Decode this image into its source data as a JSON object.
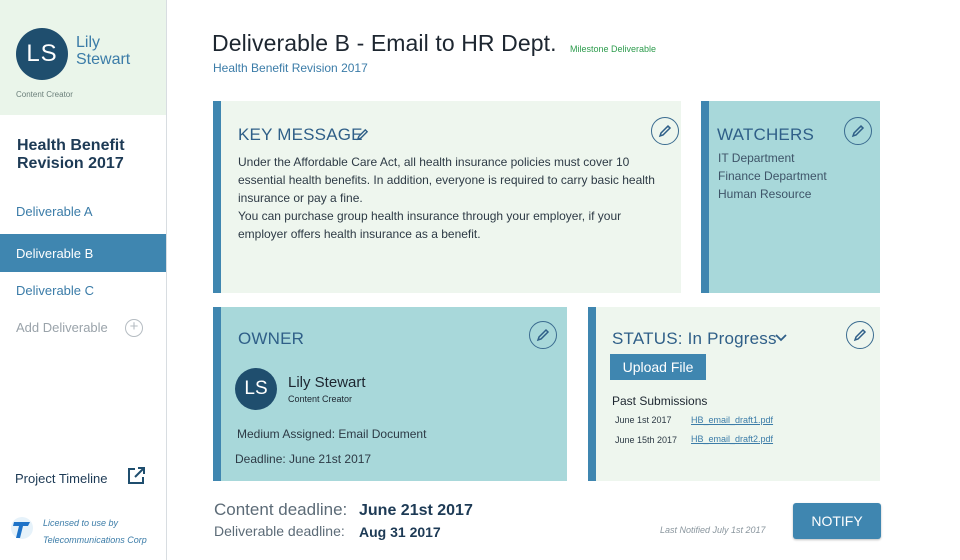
{
  "user": {
    "initials": "LS",
    "name": "Lily Stewart",
    "role": "Content Creator"
  },
  "sidebar": {
    "project_title": "Health Benefit Revision 2017",
    "items": [
      {
        "label": "Deliverable A"
      },
      {
        "label": "Deliverable B"
      },
      {
        "label": "Deliverable C"
      }
    ],
    "add_label": "Add Deliverable",
    "timeline_label": "Project Timeline",
    "license_line1": "Licensed to use by",
    "license_line2": "Telecommunications Corp"
  },
  "header": {
    "title": "Deliverable B - Email to HR Dept.",
    "badge": "Milestone Deliverable",
    "subtitle": "Health Benefit Revision 2017"
  },
  "key_message": {
    "title": "KEY MESSAGE",
    "paragraph1": "Under the Affordable Care Act, all health insurance policies must cover 10 essential health benefits. In addition, everyone is required to carry basic health insurance or pay a fine.",
    "paragraph2": "You can purchase group health insurance through your employer, if your employer offers health insurance as a benefit."
  },
  "watchers": {
    "title": "WATCHERS",
    "items": [
      "IT Department",
      "Finance Department",
      "Human Resource"
    ]
  },
  "owner": {
    "title": "OWNER",
    "initials": "LS",
    "name": "Lily Stewart",
    "role": "Content Creator",
    "medium": "Medium Assigned:  Email Document",
    "deadline": "Deadline: June 21st 2017"
  },
  "status": {
    "title": "STATUS:  In Progress",
    "upload_label": "Upload File",
    "past_label": "Past Submissions",
    "submissions": [
      {
        "date": "June 1st 2017",
        "file": "HB_email_draft1.pdf"
      },
      {
        "date": "June 15th 2017",
        "file": "HB_email_draft2.pdf"
      }
    ]
  },
  "footer": {
    "content_label": "Content deadline:",
    "content_value": "June 21st 2017",
    "deliverable_label": "Deliverable deadline:",
    "deliverable_value": "Aug 31 2017",
    "last_notified": "Last Notified July 1st 2017",
    "notify_label": "NOTIFY"
  },
  "colors": {
    "accent": "#3f86b0",
    "avatar": "#1f4e6e",
    "card_light": "#eef6ee",
    "card_teal": "#a8d8da",
    "milestone": "#2d9c4d"
  }
}
